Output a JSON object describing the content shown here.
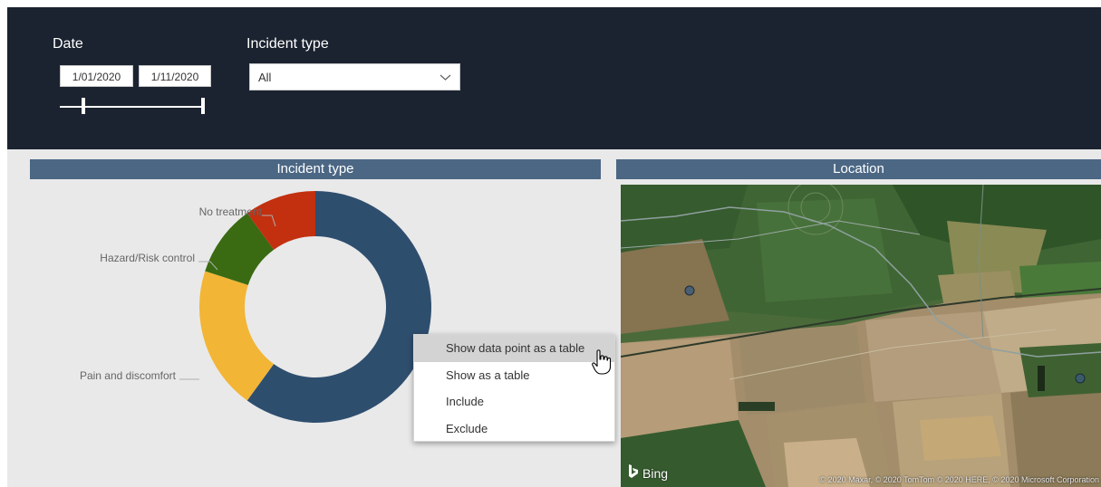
{
  "filters": {
    "date": {
      "label": "Date",
      "start": "1/01/2020",
      "end": "1/11/2020"
    },
    "incident_type": {
      "label": "Incident type",
      "selected": "All"
    }
  },
  "panels": {
    "incident_type_title": "Incident type",
    "location_title": "Location"
  },
  "chart_data": {
    "type": "pie",
    "title": "Incident type",
    "donut": true,
    "slices": [
      {
        "label": "",
        "value": 60,
        "color": "#2e4e6e"
      },
      {
        "label": "Pain and discomfort",
        "value": 20,
        "color": "#f2b535"
      },
      {
        "label": "Hazard/Risk control",
        "value": 10,
        "color": "#3a6a12"
      },
      {
        "label": "No treatment",
        "value": 10,
        "color": "#c23010"
      }
    ]
  },
  "context_menu": {
    "items": [
      "Show data point as a table",
      "Show as a table",
      "Include",
      "Exclude"
    ]
  },
  "map": {
    "provider": "Bing",
    "attribution": "© 2020 Maxar, © 2020 TomTom © 2020 HERE, © 2020 Microsoft Corporation"
  },
  "icons": {
    "dropdown": "chevron-down-icon",
    "cursor": "hand-pointer-icon",
    "bing": "bing-logo-icon"
  }
}
